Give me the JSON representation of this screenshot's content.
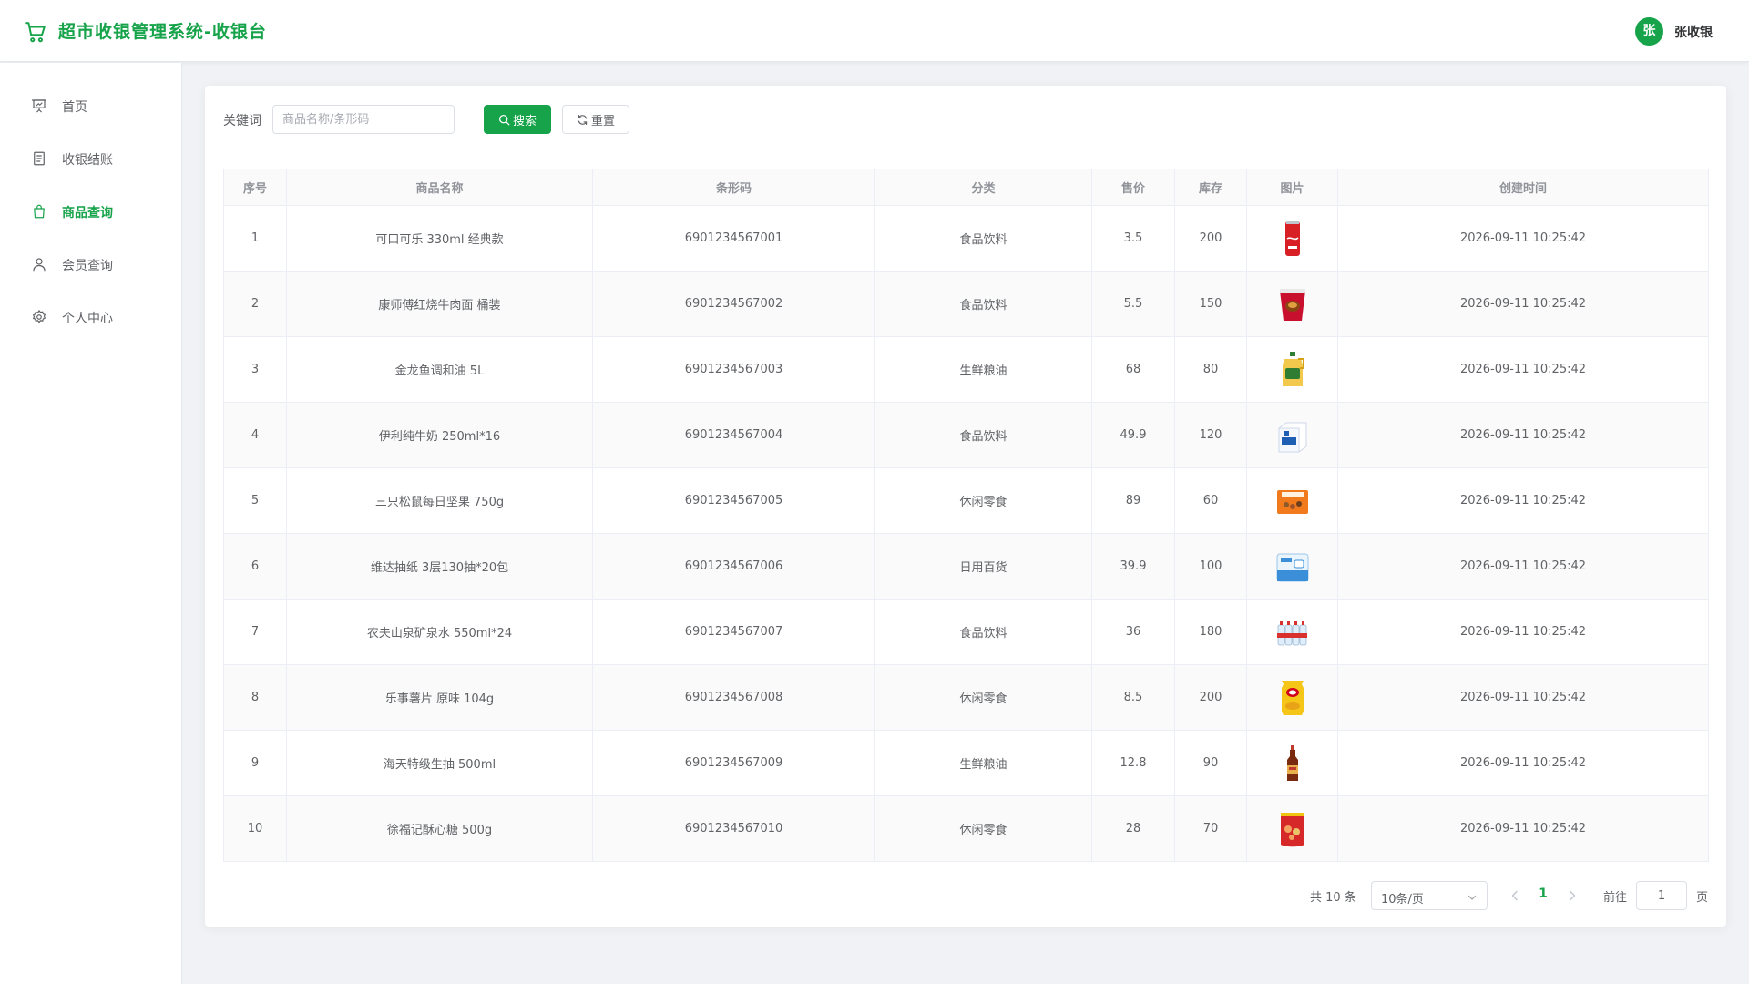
{
  "header": {
    "title": "超市收银管理系统-收银台",
    "avatar_text": "张",
    "username": "张收银"
  },
  "sidebar": {
    "items": [
      {
        "label": "首页",
        "icon": "presentation-board-icon",
        "active": false
      },
      {
        "label": "收银结账",
        "icon": "document-icon",
        "active": false
      },
      {
        "label": "商品查询",
        "icon": "shopping-bag-icon",
        "active": true
      },
      {
        "label": "会员查询",
        "icon": "user-icon",
        "active": false
      },
      {
        "label": "个人中心",
        "icon": "gear-icon",
        "active": false
      }
    ]
  },
  "search": {
    "label": "关键词",
    "placeholder": "商品名称/条形码",
    "value": "",
    "search_label": "搜索",
    "reset_label": "重置"
  },
  "table": {
    "columns": [
      "序号",
      "商品名称",
      "条形码",
      "分类",
      "售价",
      "库存",
      "图片",
      "创建时间"
    ],
    "rows": [
      {
        "index": "1",
        "name": "可口可乐 330ml 经典款",
        "barcode": "6901234567001",
        "category": "食品饮料",
        "price": "3.5",
        "stock": "200",
        "image": "cola-can",
        "created": "2026-09-11 10:25:42"
      },
      {
        "index": "2",
        "name": "康师傅红烧牛肉面 桶装",
        "barcode": "6901234567002",
        "category": "食品饮料",
        "price": "5.5",
        "stock": "150",
        "image": "noodle-bucket",
        "created": "2026-09-11 10:25:42"
      },
      {
        "index": "3",
        "name": "金龙鱼调和油 5L",
        "barcode": "6901234567003",
        "category": "生鲜粮油",
        "price": "68",
        "stock": "80",
        "image": "oil-jug",
        "created": "2026-09-11 10:25:42"
      },
      {
        "index": "4",
        "name": "伊利纯牛奶 250ml*16",
        "barcode": "6901234567004",
        "category": "食品饮料",
        "price": "49.9",
        "stock": "120",
        "image": "milk-box",
        "created": "2026-09-11 10:25:42"
      },
      {
        "index": "5",
        "name": "三只松鼠每日坚果 750g",
        "barcode": "6901234567005",
        "category": "休闲零食",
        "price": "89",
        "stock": "60",
        "image": "nut-box",
        "created": "2026-09-11 10:25:42"
      },
      {
        "index": "6",
        "name": "维达抽纸 3层130抽*20包",
        "barcode": "6901234567006",
        "category": "日用百货",
        "price": "39.9",
        "stock": "100",
        "image": "tissue-pack",
        "created": "2026-09-11 10:25:42"
      },
      {
        "index": "7",
        "name": "农夫山泉矿泉水 550ml*24",
        "barcode": "6901234567007",
        "category": "食品饮料",
        "price": "36",
        "stock": "180",
        "image": "water-bottles",
        "created": "2026-09-11 10:25:42"
      },
      {
        "index": "8",
        "name": "乐事薯片 原味 104g",
        "barcode": "6901234567008",
        "category": "休闲零食",
        "price": "8.5",
        "stock": "200",
        "image": "chips-bag",
        "created": "2026-09-11 10:25:42"
      },
      {
        "index": "9",
        "name": "海天特级生抽 500ml",
        "barcode": "6901234567009",
        "category": "生鲜粮油",
        "price": "12.8",
        "stock": "90",
        "image": "soy-bottle",
        "created": "2026-09-11 10:25:42"
      },
      {
        "index": "10",
        "name": "徐福记酥心糖 500g",
        "barcode": "6901234567010",
        "category": "休闲零食",
        "price": "28",
        "stock": "70",
        "image": "candy-bag",
        "created": "2026-09-11 10:25:42"
      }
    ]
  },
  "pagination": {
    "total_text": "共 10 条",
    "page_size": "10条/页",
    "current_page": "1",
    "goto_label": "前往",
    "goto_value": "1",
    "page_unit": "页"
  },
  "colors": {
    "accent": "#16a34a"
  }
}
